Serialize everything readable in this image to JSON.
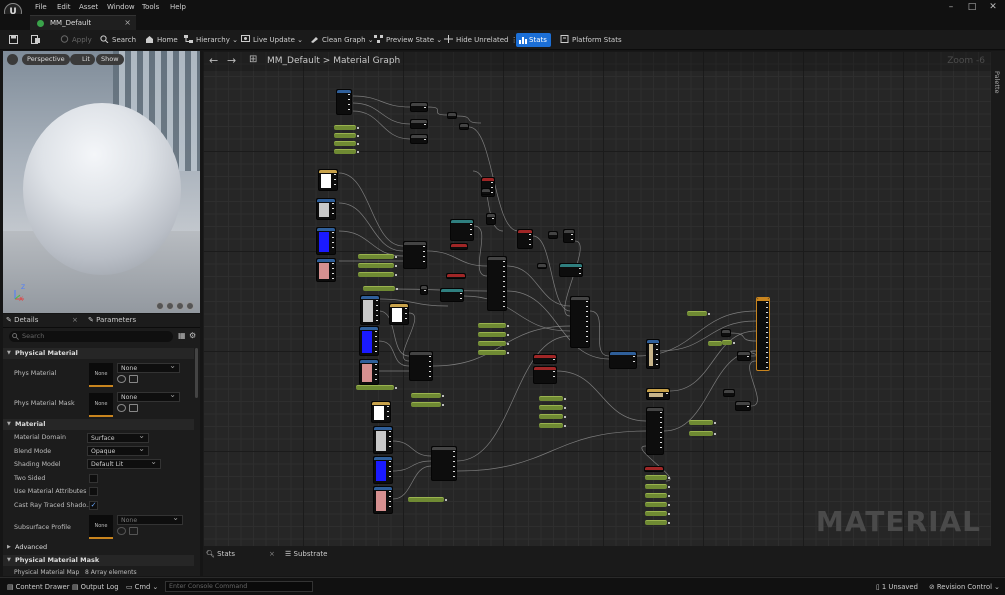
{
  "menu": [
    "File",
    "Edit",
    "Asset",
    "Window",
    "Tools",
    "Help"
  ],
  "window_controls": [
    "–",
    "□",
    "✕"
  ],
  "tab": {
    "label": "MM_Default",
    "close": "×"
  },
  "toolbar": {
    "apply": "Apply",
    "search": "Search",
    "home": "Home",
    "hierarchy": "Hierarchy",
    "live_update": "Live Update",
    "clean_graph": "Clean Graph",
    "preview_state": "Preview State",
    "hide_unrelated": "Hide Unrelated",
    "stats": "Stats",
    "platform_stats": "Platform Stats"
  },
  "viewport": {
    "perspective": "Perspective",
    "lit": "Lit",
    "show": "Show",
    "axis_z": "Z",
    "axis_x": "X"
  },
  "details": {
    "tab_details": "Details",
    "tab_parameters": "Parameters",
    "search_placeholder": "Search",
    "sections": {
      "physical_material": "Physical Material",
      "material": "Material",
      "advanced": "Advanced",
      "physical_material_mask": "Physical Material Mask"
    },
    "props": {
      "phys_material": "Phys Material",
      "phys_material_mask": "Phys Material Mask",
      "material_domain": "Material Domain",
      "blend_mode": "Blend Mode",
      "shading_model": "Shading Model",
      "two_sided": "Two Sided",
      "use_material_attributes": "Use Material Attributes",
      "cast_ray_traced": "Cast Ray Traced Shado...",
      "subsurface_profile": "Subsurface Profile",
      "physical_material_map": "Physical Material Map"
    },
    "values": {
      "none": "None",
      "surface": "Surface",
      "opaque": "Opaque",
      "default_lit": "Default Lit",
      "array_elements": "8 Array elements"
    },
    "checkmark": "✓"
  },
  "graph": {
    "title": "MM_Default",
    "separator": ">",
    "subtitle": "Material Graph",
    "zoom": "Zoom -6",
    "watermark": "MATERIAL",
    "palette": "Palette"
  },
  "bottom_tabs": {
    "stats": "Stats",
    "close": "×",
    "substrate": "Substrate"
  },
  "statusbar": {
    "content_drawer": "Content Drawer",
    "output_log": "Output Log",
    "cmd": "Cmd",
    "console_placeholder": "Enter Console Command",
    "unsaved": "1 Unsaved",
    "revision_control": "Revision Control"
  },
  "colors": {
    "accent": "#1c6fd6",
    "graph_bg": "#262626",
    "output_node": "#c8841e",
    "constant_node": "#6f8a33"
  },
  "swatches": [
    "#ffffff",
    "#c8c8c8",
    "#1a1aff",
    "#d69090",
    "#c7b48a"
  ]
}
